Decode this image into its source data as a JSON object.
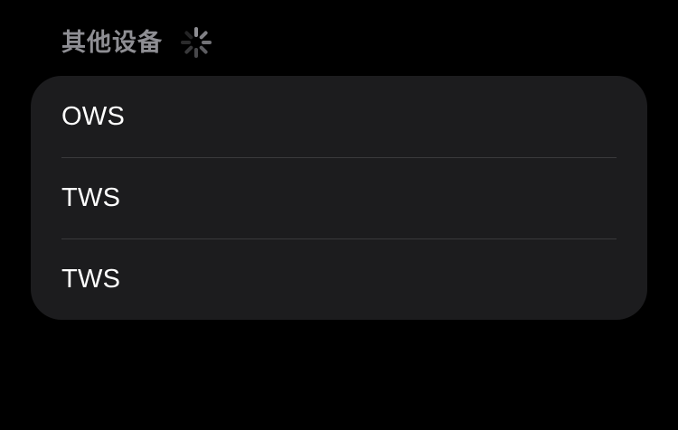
{
  "section": {
    "title": "其他设备",
    "loading_indicator": "activity-spinner-icon"
  },
  "devices": [
    {
      "name": "OWS"
    },
    {
      "name": "TWS"
    },
    {
      "name": "TWS"
    }
  ],
  "colors": {
    "background": "#000000",
    "card": "#1c1c1e",
    "header_text": "#8e8e93",
    "row_text": "#ffffff",
    "separator": "#3a3a3c"
  }
}
